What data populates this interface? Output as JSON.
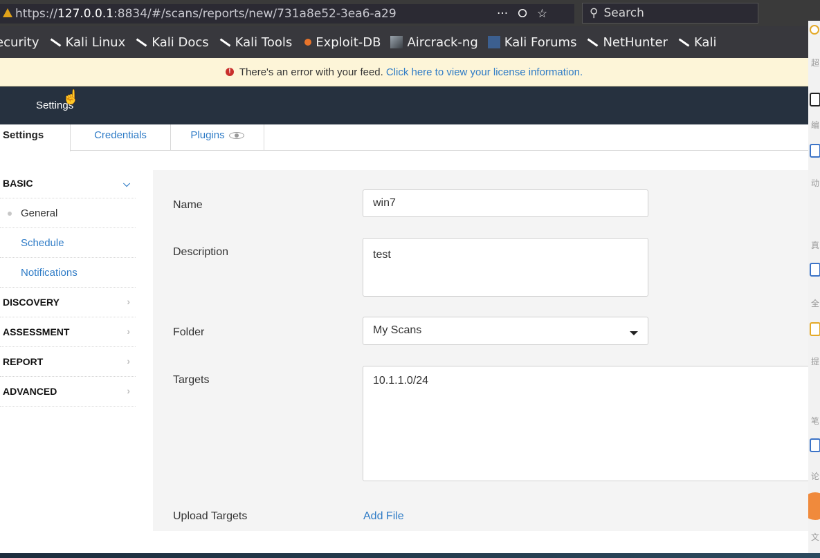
{
  "browser": {
    "url_prefix": "https://",
    "url_host": "127.0.0.1",
    "url_rest": ":8834/#/scans/reports/new/731a8e52-3ea6-a29",
    "page_actions": "···",
    "pocket_icon": "⭘",
    "bookmark_star": "☆",
    "search_placeholder": "Search",
    "search_icon": "⚲"
  },
  "bookmarks": [
    {
      "label": "ecurity",
      "icon": "none"
    },
    {
      "label": "Kali Linux",
      "icon": "dragon"
    },
    {
      "label": "Kali Docs",
      "icon": "dragon"
    },
    {
      "label": "Kali Tools",
      "icon": "dragon"
    },
    {
      "label": "Exploit-DB",
      "icon": "exploit"
    },
    {
      "label": "Aircrack-ng",
      "icon": "aircrack"
    },
    {
      "label": "Kali Forums",
      "icon": "forums"
    },
    {
      "label": "NetHunter",
      "icon": "dragon"
    },
    {
      "label": "Kali",
      "icon": "dragon"
    }
  ],
  "banner": {
    "icon": "!",
    "message": "There's an error with your feed.",
    "link": "Click here to view your license information."
  },
  "topbar": {
    "settings_link": "Settings"
  },
  "tabs": {
    "settings": "Settings",
    "credentials": "Credentials",
    "plugins": "Plugins"
  },
  "sidebar": {
    "basic": "BASIC",
    "general": "General",
    "schedule": "Schedule",
    "notifications": "Notifications",
    "discovery": "DISCOVERY",
    "assessment": "ASSESSMENT",
    "report": "REPORT",
    "advanced": "ADVANCED",
    "chevron_down": "⌄",
    "chevron_right": "›"
  },
  "form": {
    "name_label": "Name",
    "name_value": "win7",
    "description_label": "Description",
    "description_value": "test",
    "folder_label": "Folder",
    "folder_value": "My Scans",
    "targets_label": "Targets",
    "targets_value": "10.1.1.0/24",
    "upload_label": "Upload Targets",
    "add_file": "Add File"
  },
  "right_strip": {
    "chars": [
      "超",
      "编",
      "动",
      "真",
      "全",
      "提",
      "笔",
      "论",
      "文"
    ]
  },
  "colors": {
    "accent_link": "#2e7bc6",
    "topbar_bg": "#26313f",
    "banner_bg": "#fdf5d8",
    "error_red": "#c9302c"
  }
}
